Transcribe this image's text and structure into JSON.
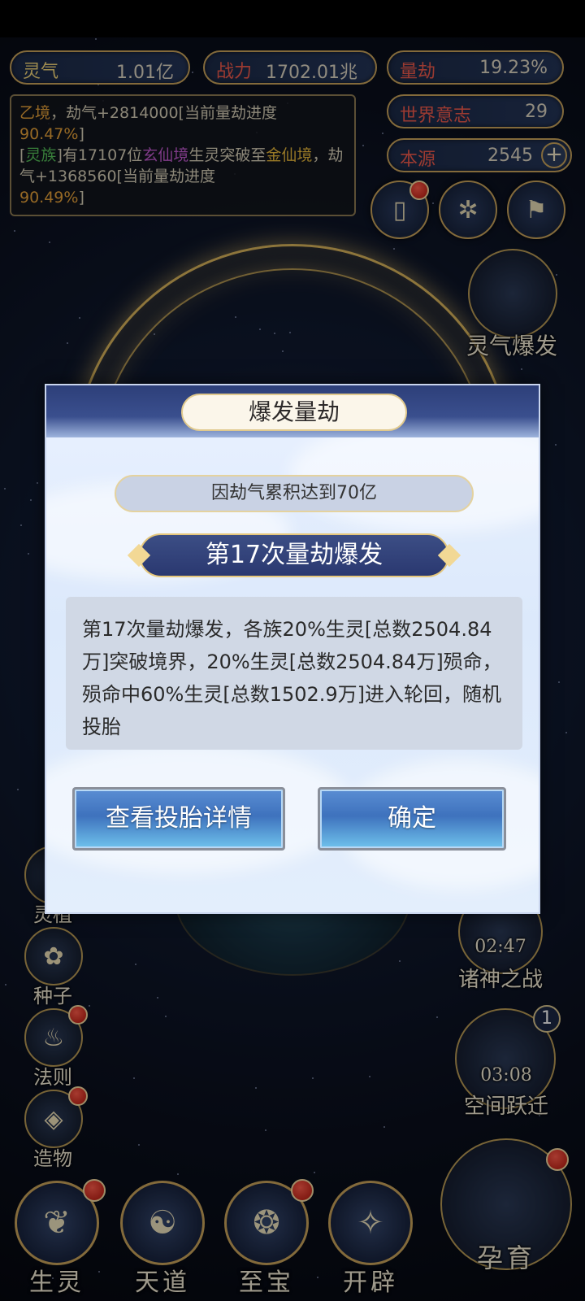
{
  "resources": {
    "lingqi": {
      "label": "灵气",
      "value": "1.01亿"
    },
    "zhanli": {
      "label": "战力",
      "value": "1702.01兆"
    },
    "liangjie": {
      "label": "量劫",
      "value": "19.23%"
    },
    "shijie": {
      "label": "世界意志",
      "value": "29"
    },
    "benyuan": {
      "label": "本源",
      "value": "2545",
      "plus": "+"
    }
  },
  "log": {
    "line1_a": "乙境",
    "line1_b": "，劫气+2814000[当前量劫进度",
    "line1_pct": "90.47%",
    "line1_end": "]",
    "line2_open": "[",
    "line2_race": "灵族",
    "line2_b": "]有17107位",
    "line2_realm1": "玄仙境",
    "line2_c": "生灵突破至",
    "line2_realm2": "金仙境",
    "line2_d": "，劫气+1368560[当前量劫进度",
    "line2_pct": "90.49%",
    "line2_end": "]"
  },
  "right_features": {
    "lingqi_baofa": "灵气爆发",
    "zhushen_timer": "02:47",
    "zhushen": "诸神之战",
    "kongjian_badge": "1",
    "kongjian_timer": "03:08",
    "kongjian": "空间跃迁",
    "yunyu": "孕育"
  },
  "left_side": [
    "灵植",
    "种子",
    "法则",
    "造物"
  ],
  "bottom_nav": [
    "生灵",
    "天道",
    "至宝",
    "开辟"
  ],
  "dialog": {
    "title": "爆发量劫",
    "reason": "因劫气累积达到70亿",
    "banner": "第17次量劫爆发",
    "description": "第17次量劫爆发，各族20%生灵[总数2504.84万]突破境界，20%生灵[总数2504.84万]殒命，殒命中60%生灵[总数1502.9万]进入轮回，随机投胎",
    "btn_detail": "查看投胎详情",
    "btn_ok": "确定"
  }
}
